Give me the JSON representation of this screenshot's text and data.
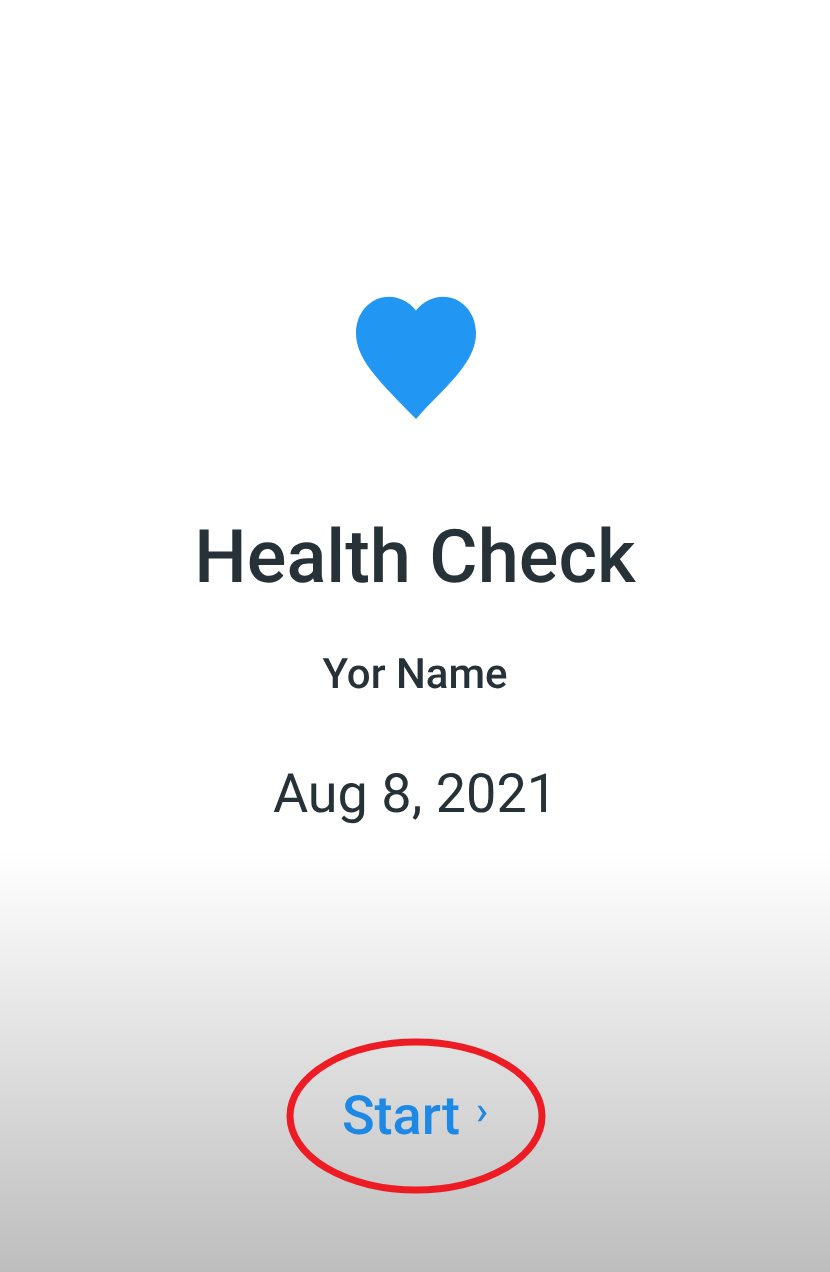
{
  "title": "Health Check",
  "name": "Yor Name",
  "date": "Aug 8, 2021",
  "start_button": {
    "label": "Start",
    "chevron": "›"
  }
}
